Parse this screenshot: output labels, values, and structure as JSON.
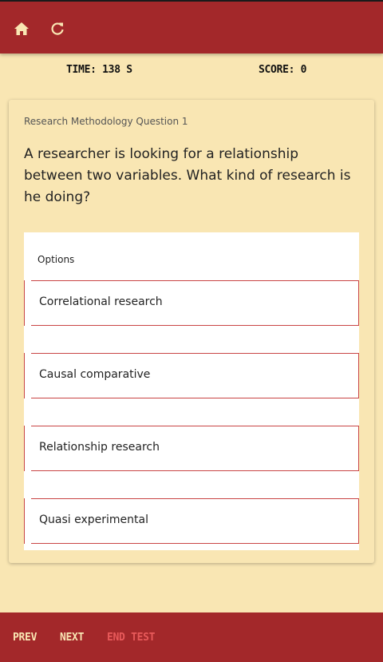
{
  "toolbar": {
    "home_icon": "home-icon",
    "refresh_icon": "refresh-icon"
  },
  "status": {
    "time": "TIME: 138 S",
    "score": "SCORE: 0"
  },
  "question": {
    "subject": "Research Methodology Question 1",
    "text": "A researcher is looking for a relationship between two variables. What kind of research is he doing?",
    "options_heading": "Options",
    "options": [
      "Correlational research",
      "Causal comparative",
      "Relationship research",
      "Quasi experimental"
    ]
  },
  "footer": {
    "prev": "PREV",
    "next": "NEXT",
    "end": "END TEST"
  },
  "colors": {
    "bar": "#a3282a",
    "background": "#f9e6b3",
    "accent_end": "#e85a5a"
  }
}
